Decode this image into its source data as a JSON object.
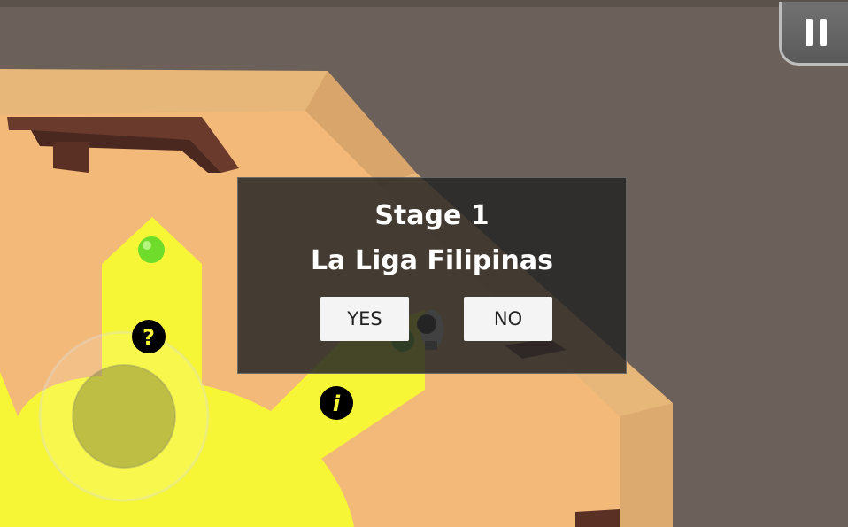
{
  "hud": {
    "pause_icon": "pause-icon"
  },
  "dialog": {
    "stage_label": "Stage 1",
    "stage_name": "La Liga Filipinas",
    "yes_label": "YES",
    "no_label": "NO"
  },
  "markers": {
    "question_glyph": "?",
    "info_glyph": "i"
  },
  "colors": {
    "ground": "#6b605a",
    "floor": "#f2b978",
    "wall_top": "#e9b97c",
    "wood": "#6a3a2c",
    "highlight": "#f6f636",
    "orb": "#6fdc2c"
  }
}
